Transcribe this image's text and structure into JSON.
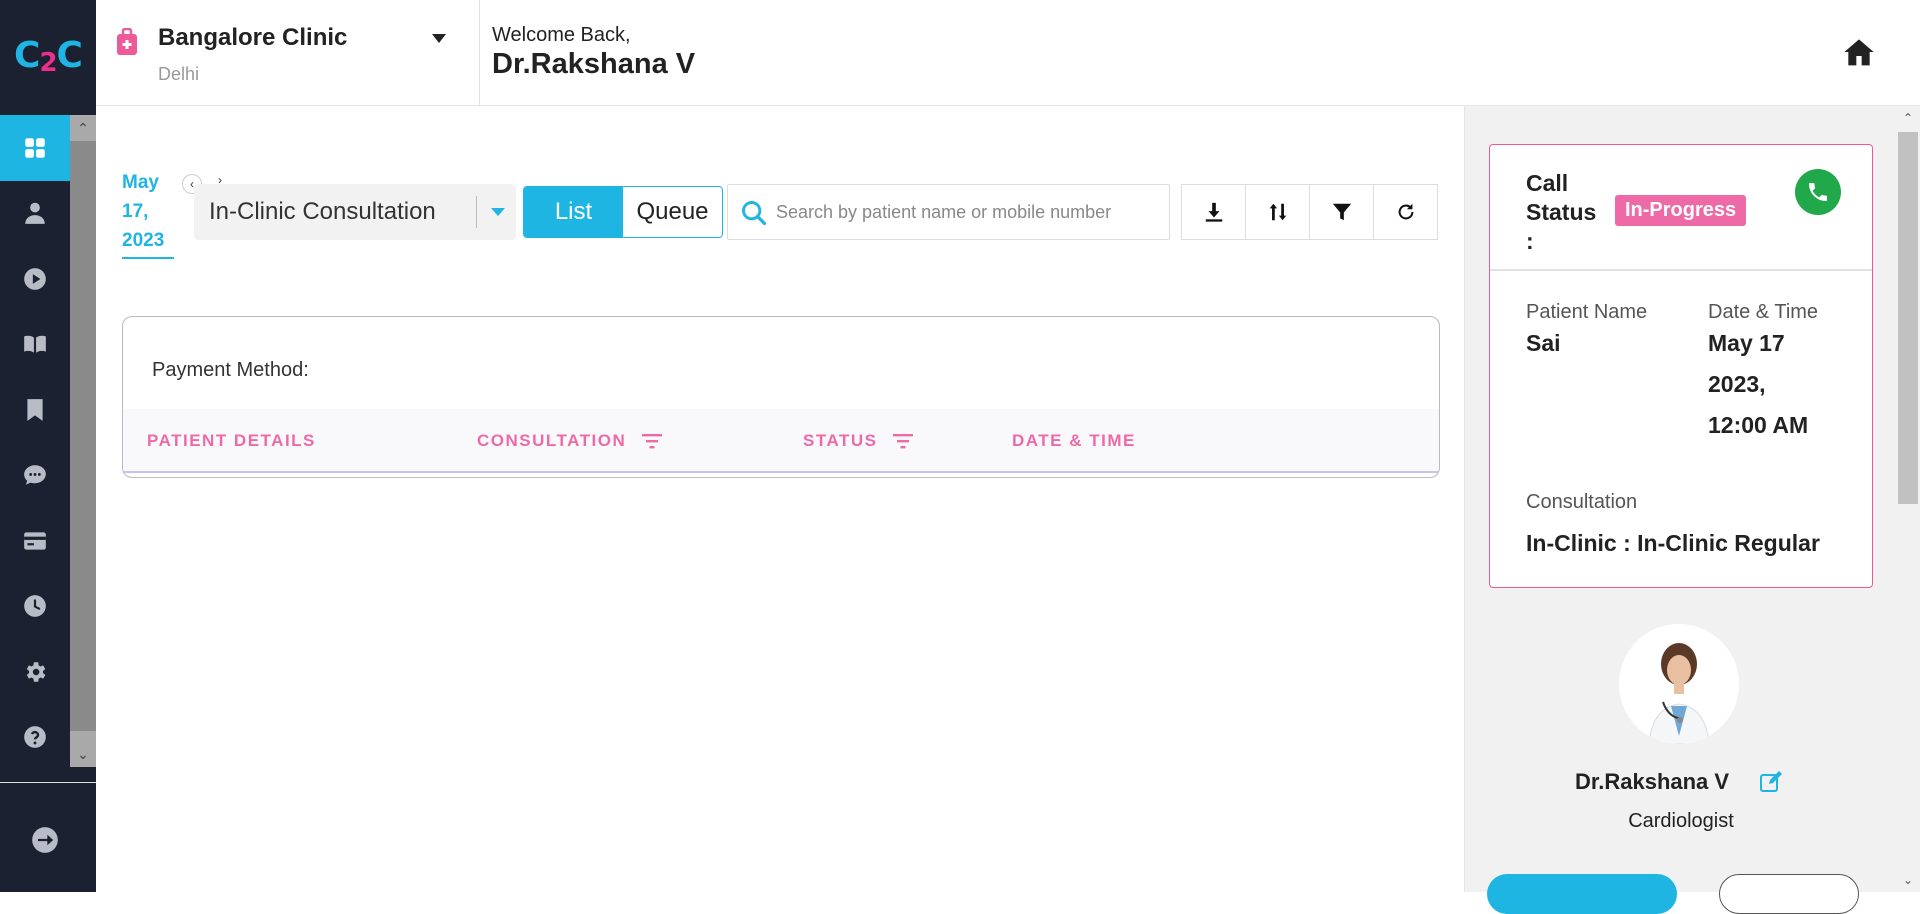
{
  "logo": {
    "c1": "C",
    "two": "2",
    "c2": "C"
  },
  "header": {
    "clinic_name": "Bangalore Clinic",
    "clinic_city": "Delhi",
    "welcome": "Welcome Back,",
    "doctor": "Dr.Rakshana V"
  },
  "sidebar": {
    "items": [
      {
        "icon": "dashboard-icon",
        "active": true
      },
      {
        "icon": "user-icon"
      },
      {
        "icon": "play-icon"
      },
      {
        "icon": "book-icon"
      },
      {
        "icon": "bookmark-icon"
      },
      {
        "icon": "chat-icon"
      },
      {
        "icon": "card-icon"
      },
      {
        "icon": "clock-icon"
      },
      {
        "icon": "gear-icon"
      },
      {
        "icon": "help-icon"
      }
    ]
  },
  "toolbar": {
    "date_line1": "May",
    "date_line2": "17,",
    "date_line3": "2023",
    "consultation_type": "In-Clinic Consultation",
    "view_list": "List",
    "view_queue": "Queue",
    "search_placeholder": "Search by patient name or mobile number"
  },
  "table": {
    "payment_label": "Payment Method:",
    "columns": [
      "PATIENT DETAILS",
      "CONSULTATION",
      "STATUS",
      "DATE & TIME"
    ]
  },
  "call_panel": {
    "call_status_label": "Call Status :",
    "status_badge": "In-Progress",
    "patient_name_label": "Patient Name",
    "patient_name": "Sai",
    "datetime_label": "Date & Time",
    "datetime_line1": "May 17",
    "datetime_line2": "2023,",
    "datetime_line3": "12:00 AM",
    "consultation_label": "Consultation",
    "consultation_value": "In-Clinic : In-Clinic Regular"
  },
  "profile": {
    "name": "Dr.Rakshana V",
    "specialty": "Cardiologist"
  },
  "colors": {
    "accent": "#1fb5e3",
    "pink": "#ee6aa7",
    "sidebar_bg": "#1b2130",
    "call_green": "#20a84a"
  }
}
